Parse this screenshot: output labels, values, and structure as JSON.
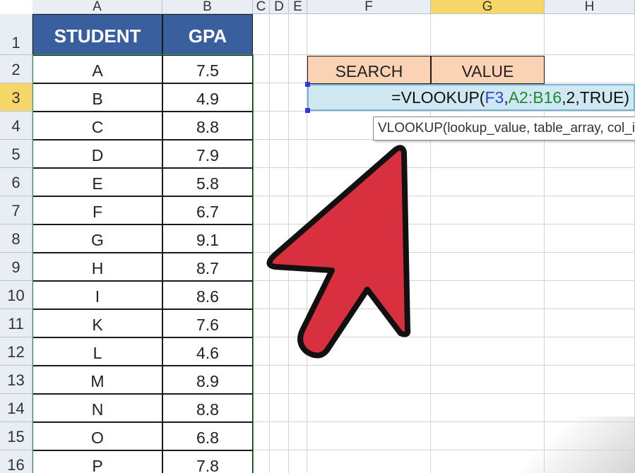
{
  "columns": [
    "A",
    "B",
    "C",
    "D",
    "E",
    "F",
    "G",
    "H"
  ],
  "selected_column": "G",
  "row_numbers": [
    "1",
    "2",
    "3",
    "4",
    "5",
    "6",
    "7",
    "8",
    "9",
    "10",
    "11",
    "12",
    "13",
    "14",
    "15",
    "16"
  ],
  "selected_row": "3",
  "table": {
    "headers": [
      "STUDENT",
      "GPA"
    ],
    "rows": [
      [
        "A",
        "7.5"
      ],
      [
        "B",
        "4.9"
      ],
      [
        "C",
        "8.8"
      ],
      [
        "D",
        "7.9"
      ],
      [
        "E",
        "5.8"
      ],
      [
        "F",
        "6.7"
      ],
      [
        "G",
        "9.1"
      ],
      [
        "H",
        "8.7"
      ],
      [
        "I",
        "8.6"
      ],
      [
        "K",
        "7.6"
      ],
      [
        "L",
        "4.6"
      ],
      [
        "M",
        "8.9"
      ],
      [
        "N",
        "8.8"
      ],
      [
        "O",
        "6.8"
      ],
      [
        "P",
        "7.8"
      ]
    ]
  },
  "lookup": {
    "search_label": "SEARCH",
    "value_label": "VALUE",
    "formula": {
      "prefix": "=VLOOKUP(",
      "arg1": "F3",
      "sep1": ",",
      "arg2": "A2:B16",
      "rest": ",2,TRUE)"
    }
  },
  "tooltip": {
    "text": "VLOOKUP(lookup_value, table_array, col_index_num, [range_lookup])"
  },
  "colors": {
    "header_fill": "#3a5f9e",
    "peach_fill": "#fbd2b3",
    "formula_fill": "#cfe8f1",
    "arrow_fill": "#d8303f",
    "selected_header": "#f5d768",
    "range_outline": "#2e9c40"
  },
  "icons": [
    "red-arrow-pointer-icon"
  ]
}
